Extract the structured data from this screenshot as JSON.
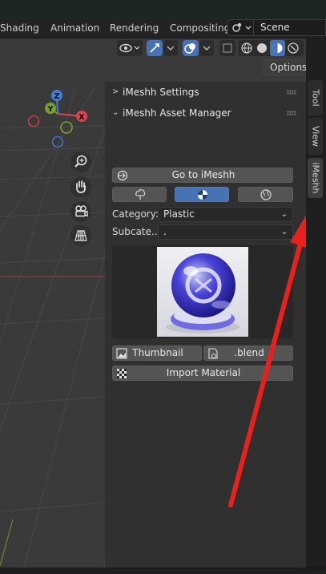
{
  "workspace_tabs": [
    "Shading",
    "Animation",
    "Rendering",
    "Compositing"
  ],
  "scene": {
    "name": "Scene"
  },
  "viewport": {
    "options_label": "Options"
  },
  "npanel": {
    "settings_title": "iMeshh Settings",
    "asset_manager_title": "iMeshh Asset Manager",
    "goto_label": "Go to iMeshh",
    "category_label": "Category:",
    "category_value": "Plastic",
    "subcategory_label": "Subcate...",
    "subcategory_value": ".",
    "thumbnail_label": "Thumbnail",
    "blend_label": ".blend",
    "import_label": "Import Material"
  },
  "side_tabs": [
    "Tool",
    "View",
    "iMeshh"
  ],
  "gizmo_axes": {
    "z": "Z",
    "y": "Y",
    "x": "X"
  },
  "colors": {
    "accent": "#4772b3",
    "annotation_arrow": "#e8211c",
    "axis_x": "#e0404f",
    "axis_y": "#7aa12a",
    "axis_z": "#3f7fe0"
  }
}
